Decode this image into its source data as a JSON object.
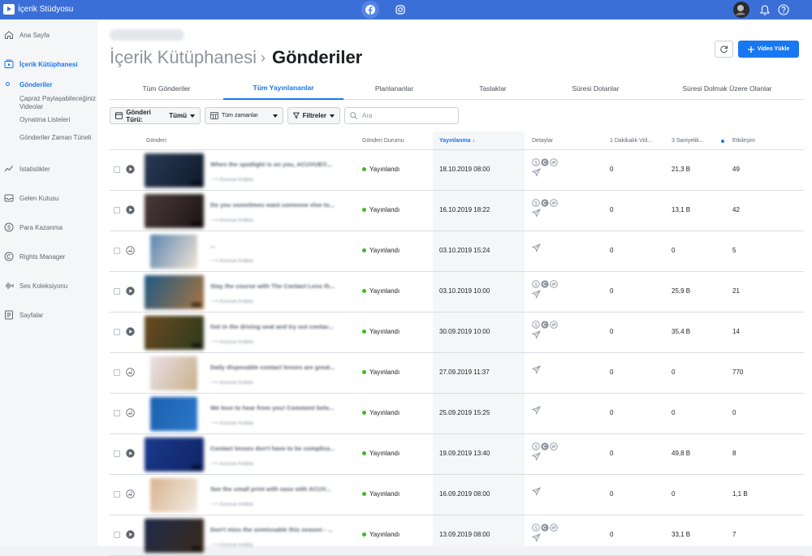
{
  "topbar": {
    "app_title": "İçerik Stüdyosu"
  },
  "sidebar": {
    "items": [
      {
        "label": "Ana Sayfa",
        "icon": "home-icon"
      },
      {
        "label": "İçerik Kütüphanesi",
        "icon": "library-icon"
      },
      {
        "label": "İstatistikler",
        "icon": "insights-icon"
      },
      {
        "label": "Gelen Kutusu",
        "icon": "inbox-icon"
      },
      {
        "label": "Para Kazanma",
        "icon": "money-icon"
      },
      {
        "label": "Rights Manager",
        "icon": "copyright-icon"
      },
      {
        "label": "Ses Koleksiyonu",
        "icon": "sound-icon"
      },
      {
        "label": "Sayfalar",
        "icon": "pages-icon"
      }
    ],
    "sub_items": [
      {
        "label": "Gönderiler"
      },
      {
        "label": "Çapraz Paylaşabileceğiniz Videolar"
      },
      {
        "label": "Oynatma Listeleri"
      },
      {
        "label": "Gönderiler Zaman Tüneli"
      }
    ]
  },
  "header": {
    "breadcrumb_parent": "İçerik Kütüphanesi",
    "breadcrumb_sep": "›",
    "breadcrumb_current": "Gönderiler",
    "upload_label": "Video Yükle"
  },
  "tabs": [
    {
      "label": "Tüm Gönderiler"
    },
    {
      "label": "Tüm Yayınlananlar"
    },
    {
      "label": "Planlananlar"
    },
    {
      "label": "Taslaklar"
    },
    {
      "label": "Süresi Dolanlar"
    },
    {
      "label": "Süresi Dolmak Üzere Olanlar"
    }
  ],
  "filters": {
    "post_type_label": "Gönderi Türü:",
    "post_type_value": "Tümü",
    "time_label": "Tüm zamanlar",
    "filters_label": "Filtreler",
    "search_placeholder": "Ara"
  },
  "table": {
    "columns": [
      "Gönderi",
      "Gönderi Durumu",
      "Yayınlanma ↓",
      "Detaylar",
      "1 Dakikalık Vid...",
      "3 Saniyelik...",
      "Etkileşim"
    ],
    "rows": [
      {
        "type": "video",
        "title": "When the spotlight is on you, ACUVUE®...",
        "author": "Acuvue Arabia",
        "status": "Yayınlandı",
        "date": "18.10.2019 08:00",
        "icons": "full",
        "min1": "0",
        "sec3": "21,3 B",
        "engagement": "49",
        "thumb": [
          "#2a3a55",
          "#0e1a2c"
        ]
      },
      {
        "type": "video",
        "title": "Do you sometimes want someone else to...",
        "author": "Acuvue Arabia",
        "status": "Yayınlandı",
        "date": "16.10.2019 18:22",
        "icons": "full",
        "min1": "0",
        "sec3": "13,1 B",
        "engagement": "42",
        "thumb": [
          "#4b3a3a",
          "#1d1414"
        ]
      },
      {
        "type": "photo",
        "title": "...",
        "author": "Acuvue Arabia",
        "status": "Yayınlandı",
        "date": "03.10.2019 15:24",
        "icons": "rocket",
        "min1": "0",
        "sec3": "0",
        "engagement": "5",
        "thumb": [
          "#5b86b0",
          "#f2e4d5"
        ]
      },
      {
        "type": "video",
        "title": "Stay the course with The Contact Lens th...",
        "author": "Acuvue Arabia",
        "status": "Yayınlandı",
        "date": "03.10.2019 10:00",
        "icons": "full",
        "min1": "0",
        "sec3": "25,9 B",
        "engagement": "21",
        "thumb": [
          "#1f5a86",
          "#a8743e"
        ]
      },
      {
        "type": "video",
        "title": "Get in the driving seat and try out contac...",
        "author": "Acuvue Arabia",
        "status": "Yayınlandı",
        "date": "30.09.2019 10:00",
        "icons": "full",
        "min1": "0",
        "sec3": "35,4 B",
        "engagement": "14",
        "thumb": [
          "#6b4a22",
          "#2c3a1a"
        ]
      },
      {
        "type": "photo",
        "title": "Daily disposable contact lenses are great...",
        "author": "Acuvue Arabia",
        "status": "Yayınlandı",
        "date": "27.09.2019 11:37",
        "icons": "rocket",
        "min1": "0",
        "sec3": "0",
        "engagement": "770",
        "thumb": [
          "#e9dfe6",
          "#c9b18c"
        ]
      },
      {
        "type": "photo",
        "title": "We love to hear from you! Comment belo...",
        "author": "Acuvue Arabia",
        "status": "Yayınlandı",
        "date": "25.09.2019 15:25",
        "icons": "rocket",
        "min1": "0",
        "sec3": "0",
        "engagement": "0",
        "thumb": [
          "#1d5fae",
          "#2a78c9"
        ]
      },
      {
        "type": "video",
        "title": "Contact lenses don't have to be complica...",
        "author": "Acuvue Arabia",
        "status": "Yayınlandı",
        "date": "19.09.2019 13:40",
        "icons": "full",
        "min1": "0",
        "sec3": "49,8 B",
        "engagement": "8",
        "thumb": [
          "#1a3a8c",
          "#0f2466"
        ]
      },
      {
        "type": "photo",
        "title": "See the small print with ease with ACUV...",
        "author": "Acuvue Arabia",
        "status": "Yayınlandı",
        "date": "16.09.2019 08:00",
        "icons": "rocket",
        "min1": "0",
        "sec3": "0",
        "engagement": "1,1 B",
        "thumb": [
          "#d7b48f",
          "#f3ece4"
        ]
      },
      {
        "type": "video",
        "title": "Don't miss the unmissable this season - ...",
        "author": "Acuvue Arabia",
        "status": "Yayınlandı",
        "date": "13.09.2019 08:00",
        "icons": "full",
        "min1": "0",
        "sec3": "33,1 B",
        "engagement": "7",
        "thumb": [
          "#1e2a4a",
          "#3a2a1a"
        ]
      }
    ]
  },
  "colors": {
    "accent": "#1877f2",
    "topbar": "#3b6fd8",
    "status_green": "#42b72a"
  }
}
